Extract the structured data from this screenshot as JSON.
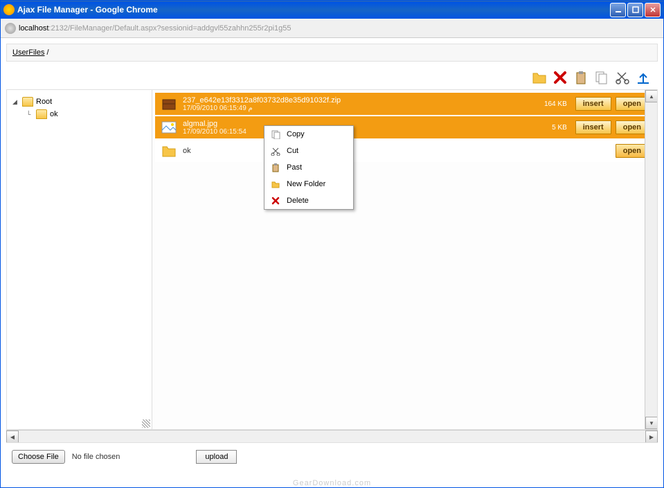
{
  "window": {
    "title": "Ajax File Manager - Google Chrome"
  },
  "address": {
    "host": "localhost",
    "path": ":2132/FileManager/Default.aspx?sessionid=addgvl55zahhn255r2pi1g55"
  },
  "breadcrumb": {
    "root": "UserFiles",
    "sep": " / "
  },
  "toolbar": {
    "new_folder": "New Folder",
    "delete": "Delete",
    "paste": "Paste",
    "copy": "Copy",
    "cut": "Cut",
    "upload": "Upload"
  },
  "tree": {
    "root": "Root",
    "children": [
      {
        "label": "ok"
      }
    ]
  },
  "files": [
    {
      "name": "237_e642e13f3312a8f03732d8e35d91032f.zip",
      "date": "17/09/2010 06:15:49 م",
      "size": "164 KB",
      "type": "zip",
      "selected": true,
      "actions": {
        "insert": "insert",
        "open": "open"
      }
    },
    {
      "name": "algmal.jpg",
      "date": "17/09/2010 06:15:54",
      "size": "5 KB",
      "type": "image",
      "selected": true,
      "actions": {
        "insert": "insert",
        "open": "open"
      }
    },
    {
      "name": "ok",
      "date": "",
      "size": "",
      "type": "folder",
      "selected": false,
      "actions": {
        "open": "open"
      }
    }
  ],
  "context_menu": [
    {
      "icon": "copy-icon",
      "label": "Copy"
    },
    {
      "icon": "cut-icon",
      "label": "Cut"
    },
    {
      "icon": "paste-icon",
      "label": "Past"
    },
    {
      "icon": "folder-icon",
      "label": "New Folder"
    },
    {
      "icon": "delete-icon",
      "label": "Delete"
    }
  ],
  "upload": {
    "choose": "Choose File",
    "no_file": "No file chosen",
    "button": "upload"
  },
  "watermark": "GearDownload.com"
}
